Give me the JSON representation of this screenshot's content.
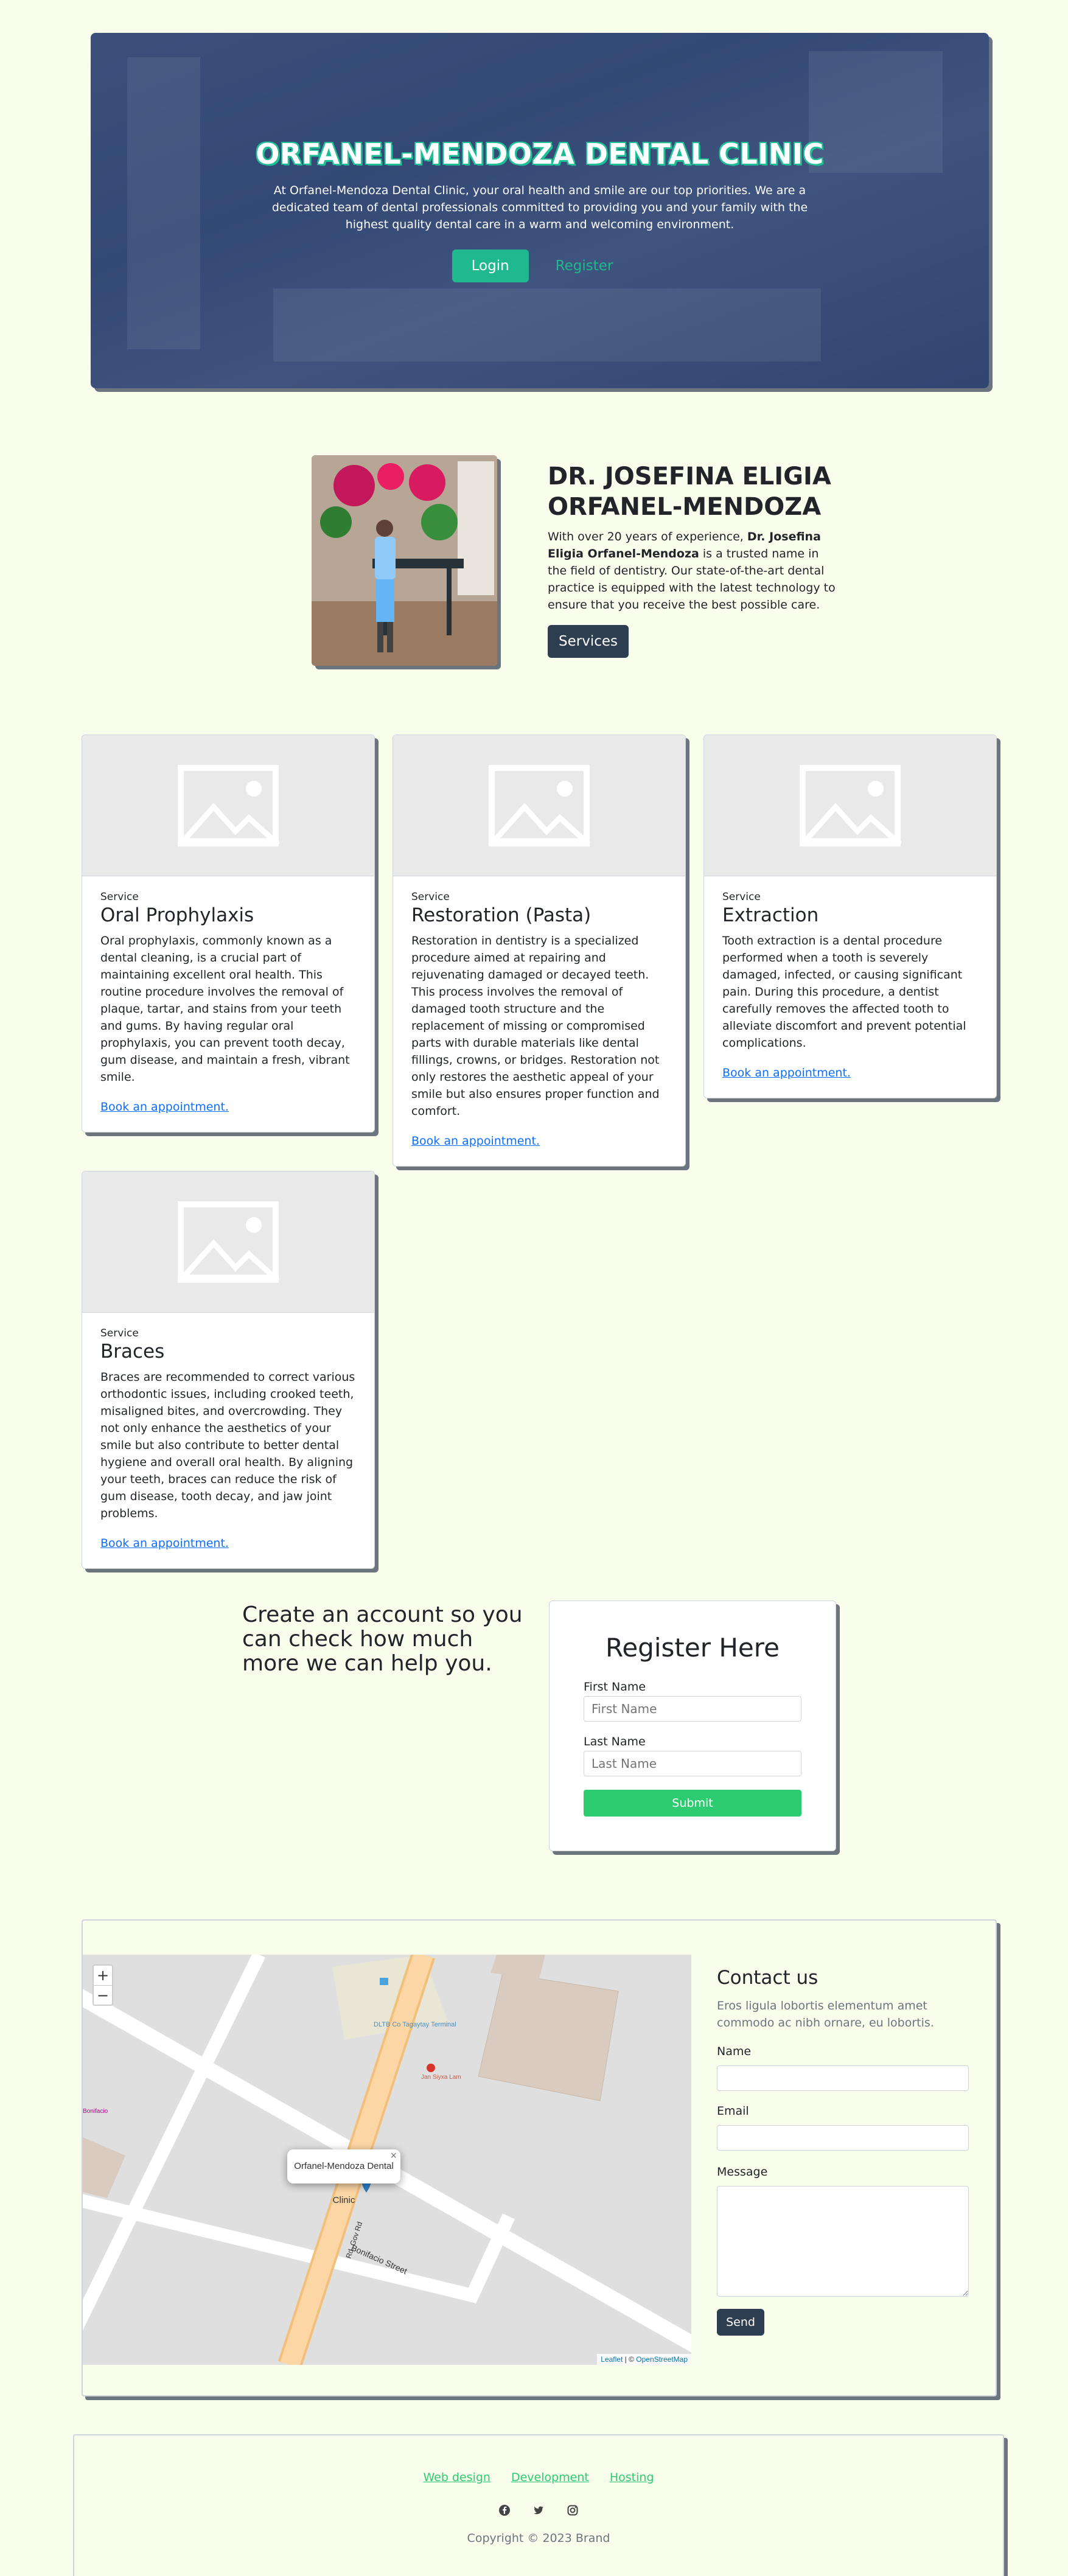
{
  "hero": {
    "title": "ORFANEL-MENDOZA DENTAL CLINIC",
    "text": "At Orfanel-Mendoza Dental Clinic, your oral health and smile are our top priorities. We are a dedicated team of dental professionals committed to providing you and your family with the highest quality dental care in a warm and welcoming environment.",
    "login_label": "Login",
    "register_label": "Register"
  },
  "about": {
    "title": "DR. JOSEFINA ELIGIA ORFANEL-MENDOZA",
    "text_before": "With over 20 years of experience, ",
    "doctor_name": "Dr. Josefina Eligia Orfanel-Mendoza",
    "text_after": " is a trusted name in the field of dentistry. Our state-of-the-art dental practice is equipped with the latest technology to ensure that you receive the best possible care.",
    "services_label": "Services"
  },
  "services": [
    {
      "kicker": "Service",
      "title": "Oral Prophylaxis",
      "description": "Oral prophylaxis, commonly known as a dental cleaning, is a crucial part of maintaining excellent oral health. This routine procedure involves the removal of plaque, tartar, and stains from your teeth and gums. By having regular oral prophylaxis, you can prevent tooth decay, gum disease, and maintain a fresh, vibrant smile.",
      "link": "Book an appointment."
    },
    {
      "kicker": "Service",
      "title": "Restoration (Pasta)",
      "description": "Restoration in dentistry is a specialized procedure aimed at repairing and rejuvenating damaged or decayed teeth. This process involves the removal of damaged tooth structure and the replacement of missing or compromised parts with durable materials like dental fillings, crowns, or bridges. Restoration not only restores the aesthetic appeal of your smile but also ensures proper function and comfort.",
      "link": "Book an appointment."
    },
    {
      "kicker": "Service",
      "title": "Extraction",
      "description": "Tooth extraction is a dental procedure performed when a tooth is severely damaged, infected, or causing significant pain. During this procedure, a dentist carefully removes the affected tooth to alleviate discomfort and prevent potential complications.",
      "link": "Book an appointment."
    },
    {
      "kicker": "Service",
      "title": "Braces",
      "description": "Braces are recommended to correct various orthodontic issues, including crooked teeth, misaligned bites, and overcrowding. They not only enhance the aesthetics of your smile but also contribute to better dental hygiene and overall oral health. By aligning your teeth, braces can reduce the risk of gum disease, tooth decay, and jaw joint problems.",
      "link": "Book an appointment."
    }
  ],
  "register": {
    "copy": "Create an account so you can check how much more we can help you.",
    "heading": "Register Here",
    "first_name_label": "First Name",
    "first_name_placeholder": "First Name",
    "last_name_label": "Last Name",
    "last_name_placeholder": "Last Name",
    "submit_label": "Submit"
  },
  "map": {
    "popup": "Orfanel-Mendoza Dental Clinic",
    "street_1": "Bonifacio Street",
    "street_2": "Rd. Gov Rd",
    "poi_1": "DLTB Co Tagaytay Terminal",
    "poi_2": "Jan Siyxa Lam",
    "poi_3": "Bonifacio",
    "attribution_leaflet": "Leaflet",
    "attribution_sep": " | © ",
    "attribution_osm": "OpenStreetMap"
  },
  "contact": {
    "title": "Contact us",
    "subtitle": "Eros ligula lobortis elementum amet commodo ac nibh ornare, eu lobortis.",
    "name_label": "Name",
    "email_label": "Email",
    "message_label": "Message",
    "send_label": "Send"
  },
  "footer": {
    "links": [
      "Web design",
      "Development",
      "Hosting"
    ],
    "social_icons": [
      "facebook-icon",
      "twitter-icon",
      "instagram-icon"
    ],
    "copyright": "Copyright © 2023 Brand"
  },
  "colors": {
    "page_bg": "#f9fdec",
    "accent_teal": "#1fb88f",
    "dark_navy": "#2c3e50",
    "green": "#2ecc71",
    "link_blue": "#0d6efd"
  }
}
